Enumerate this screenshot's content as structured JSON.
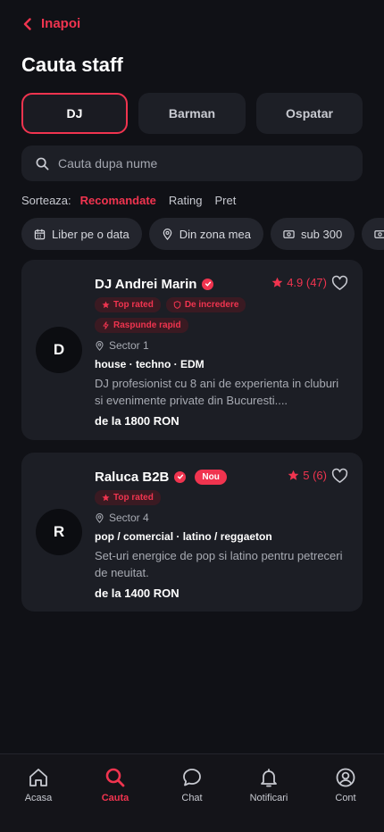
{
  "nav": {
    "back_label": "Inapoi"
  },
  "page": {
    "title": "Cauta staff"
  },
  "categories": [
    {
      "label": "DJ",
      "active": true
    },
    {
      "label": "Barman",
      "active": false
    },
    {
      "label": "Ospatar",
      "active": false
    }
  ],
  "search": {
    "placeholder": "Cauta dupa nume"
  },
  "sort": {
    "label": "Sorteaza:",
    "options": [
      "Recomandate",
      "Rating",
      "Pret"
    ],
    "selected": "Recomandate"
  },
  "filters": [
    {
      "label": "Liber pe o data",
      "icon": "calendar-icon"
    },
    {
      "label": "Din zona mea",
      "icon": "location-pin-icon"
    },
    {
      "label": "sub 300",
      "icon": "cash-icon"
    }
  ],
  "results": [
    {
      "initial": "D",
      "name": "DJ Andrei Marin",
      "verified": true,
      "rating": "4.9 (47)",
      "badges": [
        {
          "label": "Top rated",
          "icon": "star-icon"
        },
        {
          "label": "De incredere",
          "icon": "shield-icon"
        },
        {
          "label": "Raspunde rapid",
          "icon": "bolt-icon"
        }
      ],
      "location": "Sector 1",
      "genres": "house · techno · EDM",
      "description": "DJ profesionist cu 8 ani de experienta in cluburi si evenimente private din Bucuresti....",
      "price": "de la 1800 RON"
    },
    {
      "initial": "R",
      "name": "Raluca B2B",
      "verified": true,
      "new_badge": "Nou",
      "rating": "5 (6)",
      "badges": [
        {
          "label": "Top rated",
          "icon": "star-icon"
        }
      ],
      "location": "Sector 4",
      "genres": "pop / comercial · latino / reggaeton",
      "description": "Set-uri energice de pop si latino pentru petreceri de neuitat.",
      "price": "de la 1400 RON"
    }
  ],
  "tabbar": [
    {
      "label": "Acasa",
      "icon": "home-icon",
      "active": false
    },
    {
      "label": "Cauta",
      "icon": "search-icon",
      "active": true
    },
    {
      "label": "Chat",
      "icon": "chat-icon",
      "active": false
    },
    {
      "label": "Notificari",
      "icon": "bell-icon",
      "active": false
    },
    {
      "label": "Cont",
      "icon": "account-icon",
      "active": false
    }
  ],
  "colors": {
    "accent": "#f0344f",
    "background": "#101116",
    "card": "#1c1e25"
  }
}
